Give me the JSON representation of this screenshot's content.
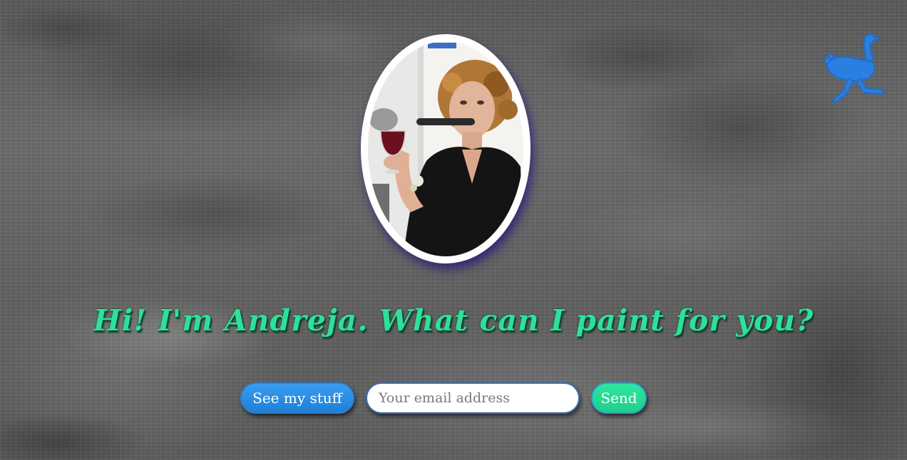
{
  "logo": {
    "icon": "ostrich-logo-icon",
    "color": "#2b7fe0"
  },
  "portrait": {
    "alt": "Portrait of Andreja holding a wine glass"
  },
  "headline": "Hi! I'm Andreja. What can I paint for you?",
  "buttons": {
    "see_stuff": "See my stuff",
    "send": "Send"
  },
  "email": {
    "placeholder": "Your email address",
    "value": ""
  },
  "colors": {
    "headline": "#2ee09a",
    "primary_button": "#2b8ee8",
    "send_button": "#26d993",
    "frame_shadow": "#281e78"
  }
}
